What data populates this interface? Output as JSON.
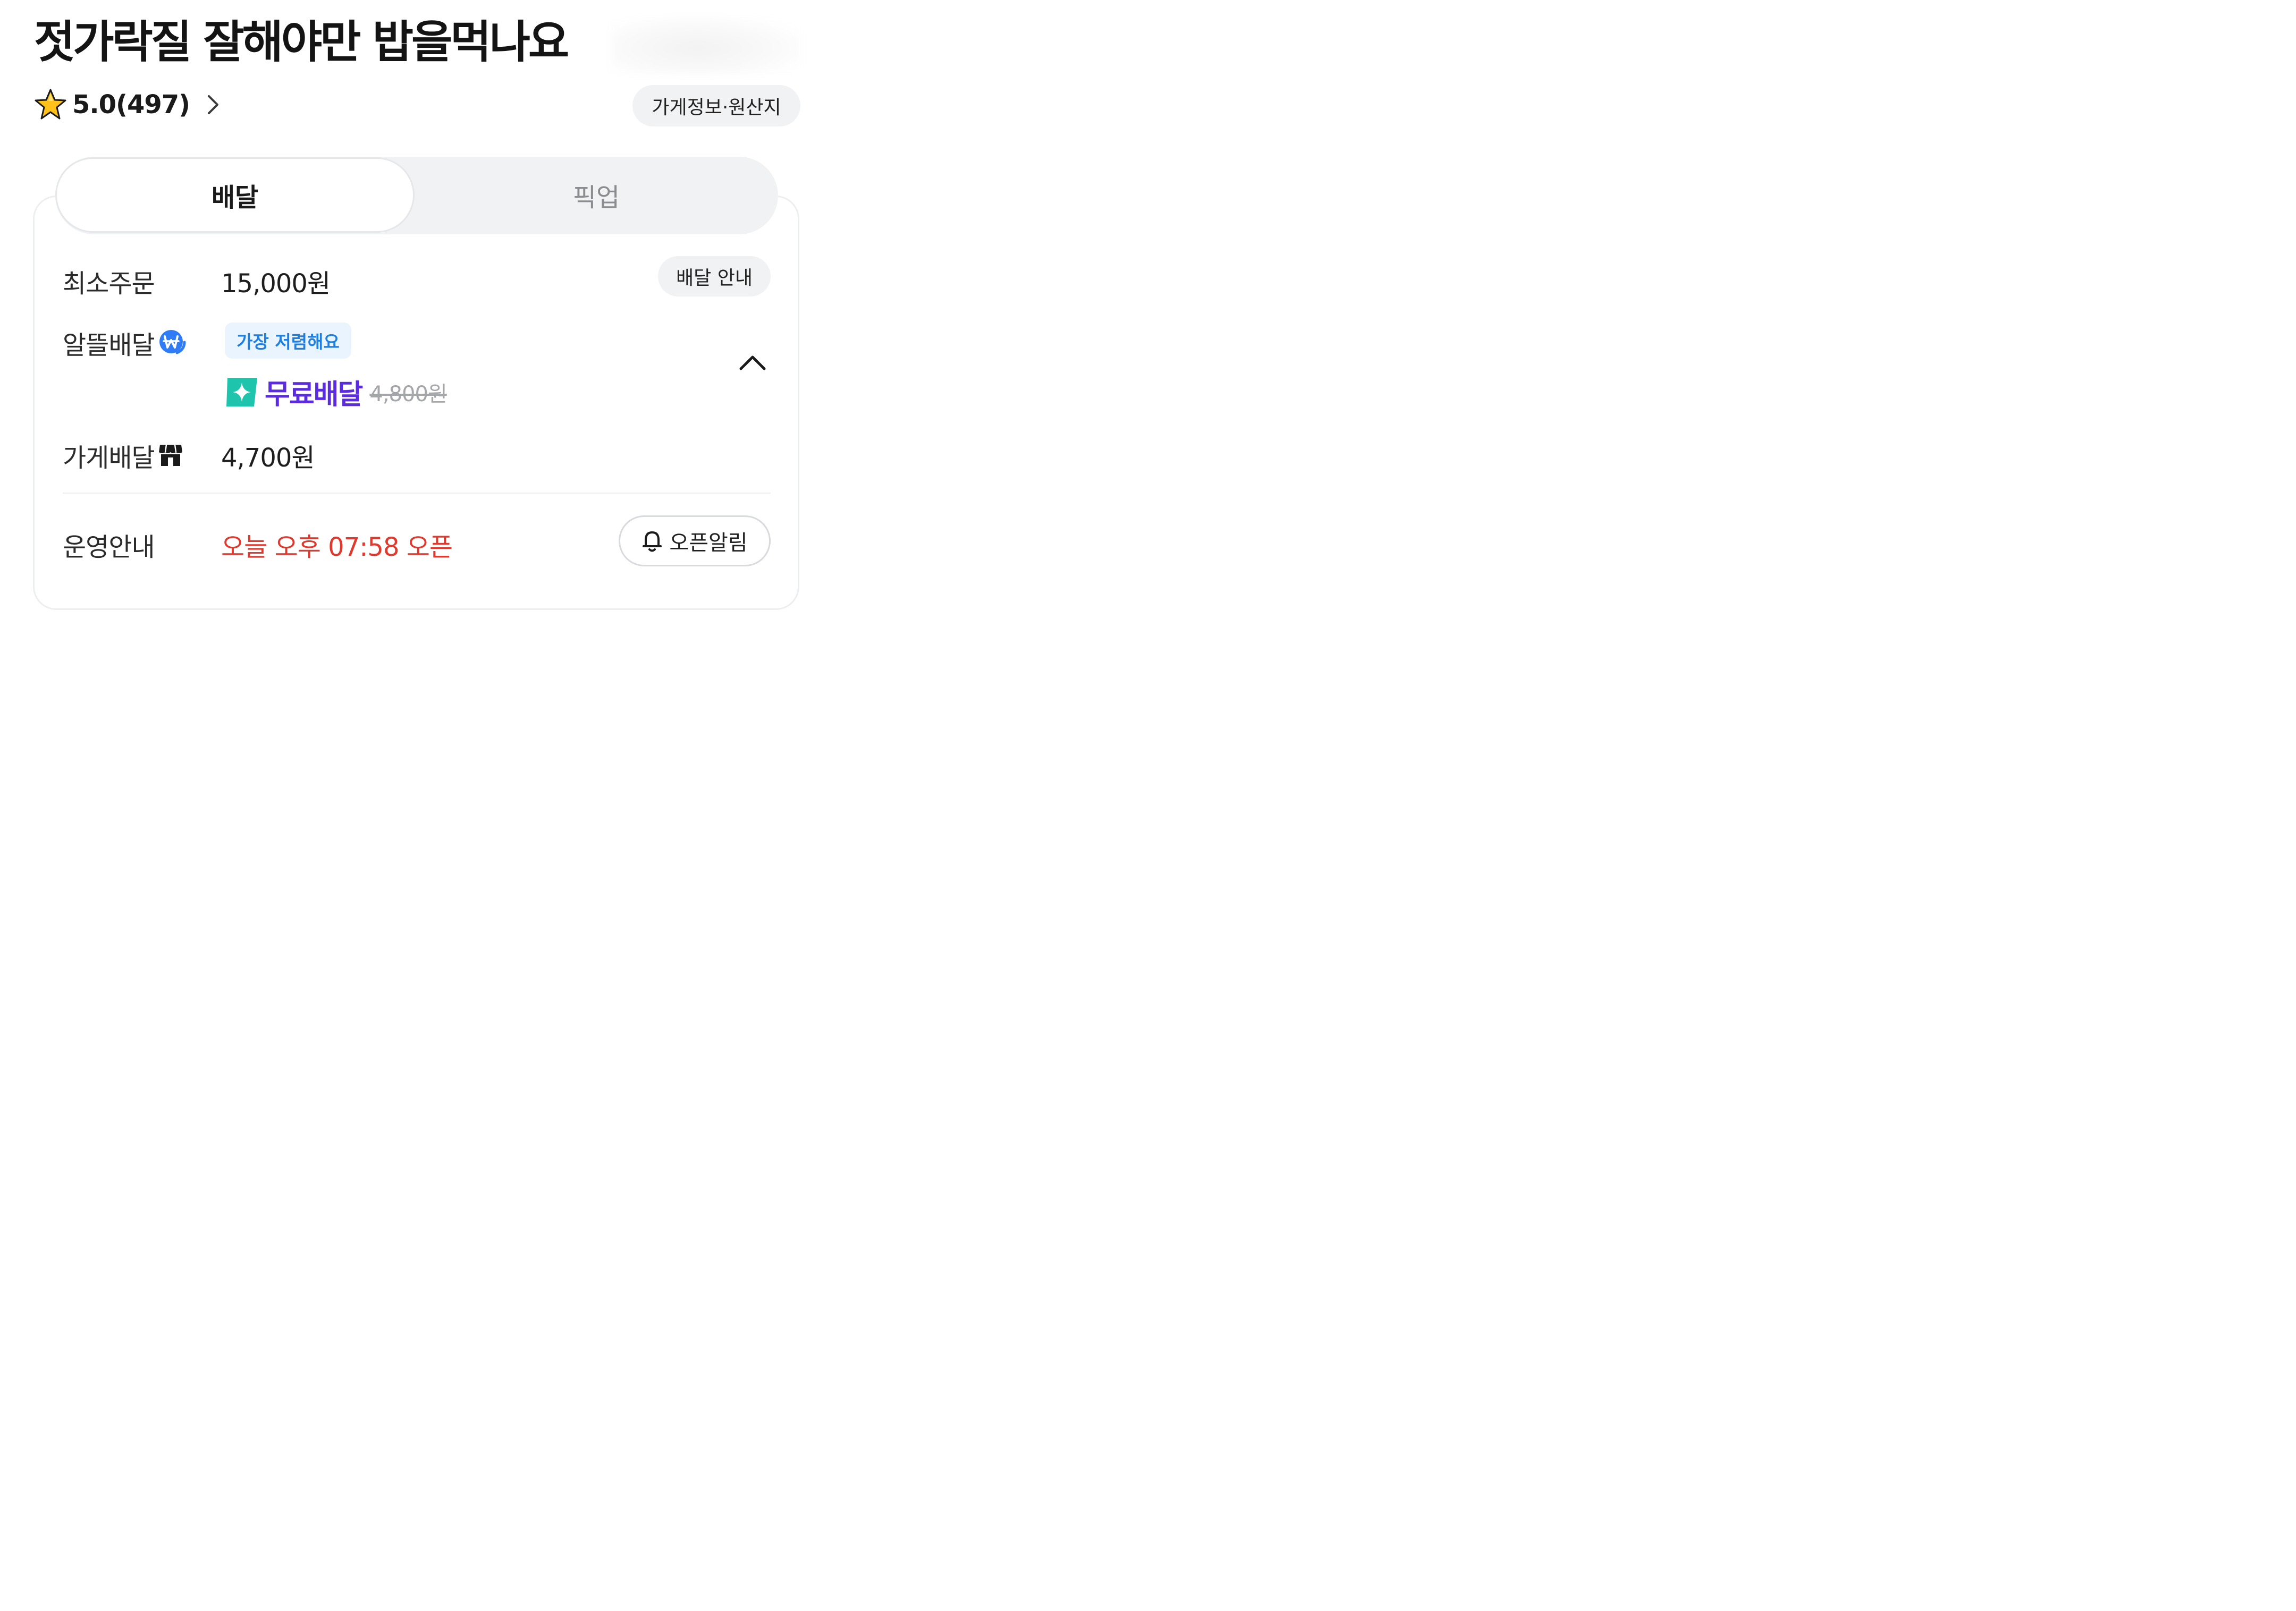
{
  "store": {
    "name": "젓가락질 잘해야만 밥을먹나요",
    "rating": "5.0(497)",
    "info_button": "가게정보·원산지"
  },
  "tabs": [
    {
      "label": "배달",
      "active": true
    },
    {
      "label": "픽업",
      "active": false
    }
  ],
  "delivery": {
    "min_order_label": "최소주문",
    "min_order_value": "15,000원",
    "guide_button": "배달 안내",
    "saver_label": "알뜰배달",
    "saver_badge": "가장 저렴해요",
    "saver_free_label": "무료배달",
    "saver_original_price": "4,800원",
    "store_delivery_label": "가게배달",
    "store_delivery_value": "4,700원"
  },
  "operation": {
    "label": "운영안내",
    "status": "오늘 오후 07:58 오픈",
    "alert_button": "오픈알림"
  },
  "colors": {
    "accent_purple": "#5b2be0",
    "badge_blue": "#1e7fe0",
    "won_icon_blue": "#2f7cf6",
    "open_red": "#e2392e",
    "mint": "#1fc4ad"
  },
  "icons": [
    "star-icon",
    "chevron-right-icon",
    "won-coin-icon",
    "sparkle-icon",
    "chevron-up-icon",
    "store-icon",
    "bell-icon"
  ]
}
